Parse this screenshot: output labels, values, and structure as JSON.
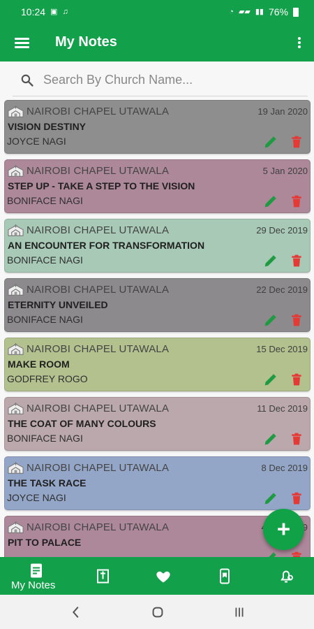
{
  "status_bar": {
    "time": "10:24",
    "left_icons": [
      "image-icon",
      "notification-icon"
    ],
    "right_icons": [
      "alarm-icon",
      "signal-icon",
      "signal-icon"
    ],
    "battery": "76%"
  },
  "app_bar": {
    "title": "My Notes",
    "menu_icon": "hamburger-menu-icon",
    "more_icon": "more-vertical-icon"
  },
  "search": {
    "placeholder": "Search By Church Name..."
  },
  "notes": [
    {
      "church": "NAIROBI CHAPEL UTAWALA",
      "date": "19 Jan 2020",
      "title": "VISION DESTINY",
      "speaker": "JOYCE NAGI",
      "color": "#8e8e8e"
    },
    {
      "church": "NAIROBI CHAPEL UTAWALA",
      "date": "5 Jan 2020",
      "title": "STEP UP - TAKE A STEP TO THE VISION",
      "speaker": "BONIFACE NAGI",
      "color": "#ad8899"
    },
    {
      "church": "NAIROBI CHAPEL UTAWALA",
      "date": "29 Dec 2019",
      "title": "AN ENCOUNTER FOR TRANSFORMATION",
      "speaker": "BONIFACE NAGI",
      "color": "#a7c9b6"
    },
    {
      "church": "NAIROBI CHAPEL UTAWALA",
      "date": "22 Dec 2019",
      "title": "ETERNITY UNVEILED",
      "speaker": "BONIFACE NAGI",
      "color": "#8c8a8d"
    },
    {
      "church": "NAIROBI CHAPEL UTAWALA",
      "date": "15 Dec 2019",
      "title": "MAKE ROOM",
      "speaker": "GODFREY ROGO",
      "color": "#b2c18e"
    },
    {
      "church": "NAIROBI CHAPEL UTAWALA",
      "date": "11 Dec 2019",
      "title": "THE COAT OF MANY COLOURS",
      "speaker": "BONIFACE NAGI",
      "color": "#bba8ad"
    },
    {
      "church": "NAIROBI CHAPEL UTAWALA",
      "date": "8 Dec 2019",
      "title": "THE TASK RACE",
      "speaker": "JOYCE NAGI",
      "color": "#94a6c8"
    },
    {
      "church": "NAIROBI CHAPEL UTAWALA",
      "date": "4 Dec 2019",
      "title": "PIT TO PALACE",
      "speaker": "",
      "color": "#ad889a"
    }
  ],
  "fab": {
    "label": "+"
  },
  "bottom_nav": {
    "items": [
      {
        "label": "My Notes",
        "icon": "notes-icon"
      },
      {
        "label": "",
        "icon": "bible-icon"
      },
      {
        "label": "",
        "icon": "heart-icon"
      },
      {
        "label": "",
        "icon": "phone-bookmark-icon"
      },
      {
        "label": "",
        "icon": "bell-settings-icon"
      }
    ]
  },
  "colors": {
    "primary": "#12a04a",
    "edit": "#1e9b42",
    "delete": "#e53935"
  }
}
